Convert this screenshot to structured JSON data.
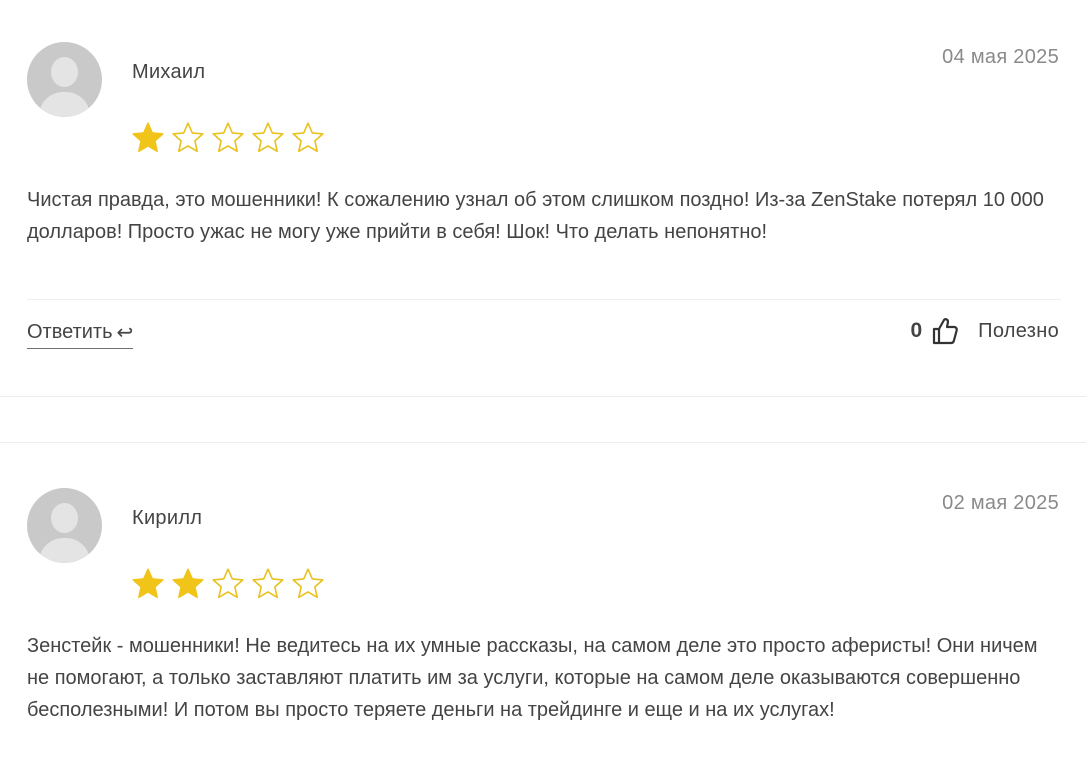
{
  "reviews": [
    {
      "author": "Михаил",
      "date": "04 мая 2025",
      "rating": 1,
      "max_rating": 5,
      "text": "Чистая правда, это мошенники! К сожалению узнал об этом слишком поздно! Из-за ZenStake потерял 10 000 долларов! Просто ужас не могу уже прийти в себя! Шок! Что делать непонятно!",
      "reply_label": "Ответить",
      "reply_icon": "↩",
      "helpful_count": "0",
      "helpful_label": "Полезно"
    },
    {
      "author": "Кирилл",
      "date": "02 мая 2025",
      "rating": 2,
      "max_rating": 5,
      "text": "Зенстейк - мошенники! Не ведитесь на их умные рассказы, на самом деле это просто аферисты! Они ничем не помогают, а только заставляют платить им за услуги, которые на самом деле оказываются совершенно бесполезными! И потом вы просто теряете деньги на трейдинге и еще и на их услугах!"
    }
  ],
  "colors": {
    "star_filled": "#f0c419",
    "star_outline": "#e8c21c",
    "text": "#444444",
    "date": "#8a8a8a",
    "avatar_bg": "#c9c9c9"
  }
}
